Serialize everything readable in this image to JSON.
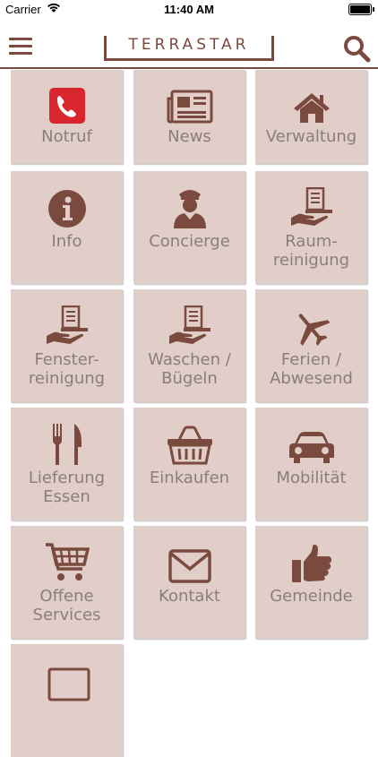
{
  "status": {
    "carrier": "Carrier",
    "time": "11:40 AM"
  },
  "header": {
    "logo": "TERRASTAR"
  },
  "tiles": [
    {
      "label": "Notruf",
      "icon": "phone-emergency-icon"
    },
    {
      "label": "News",
      "icon": "newspaper-icon"
    },
    {
      "label": "Verwaltung",
      "icon": "home-icon"
    },
    {
      "label": "Info",
      "icon": "info-icon"
    },
    {
      "label": "Concierge",
      "icon": "concierge-icon"
    },
    {
      "label": "Raum-\nreinigung",
      "icon": "service-list-icon"
    },
    {
      "label": "Fenster-\nreinigung",
      "icon": "service-list-icon"
    },
    {
      "label": "Waschen /\nBügeln",
      "icon": "service-list-icon"
    },
    {
      "label": "Ferien /\nAbwesend",
      "icon": "airplane-icon"
    },
    {
      "label": "Lieferung\nEssen",
      "icon": "cutlery-icon"
    },
    {
      "label": "Einkaufen",
      "icon": "basket-icon"
    },
    {
      "label": "Mobilität",
      "icon": "car-icon"
    },
    {
      "label": "Offene\nServices",
      "icon": "shopping-cart-icon"
    },
    {
      "label": "Kontakt",
      "icon": "envelope-icon"
    },
    {
      "label": "Gemeinde",
      "icon": "thumbs-up-icon"
    }
  ],
  "colors": {
    "brand": "#7b4a3f",
    "tile": "#e1cec8",
    "label": "#8a7e7b",
    "emergency": "#d9262c"
  }
}
